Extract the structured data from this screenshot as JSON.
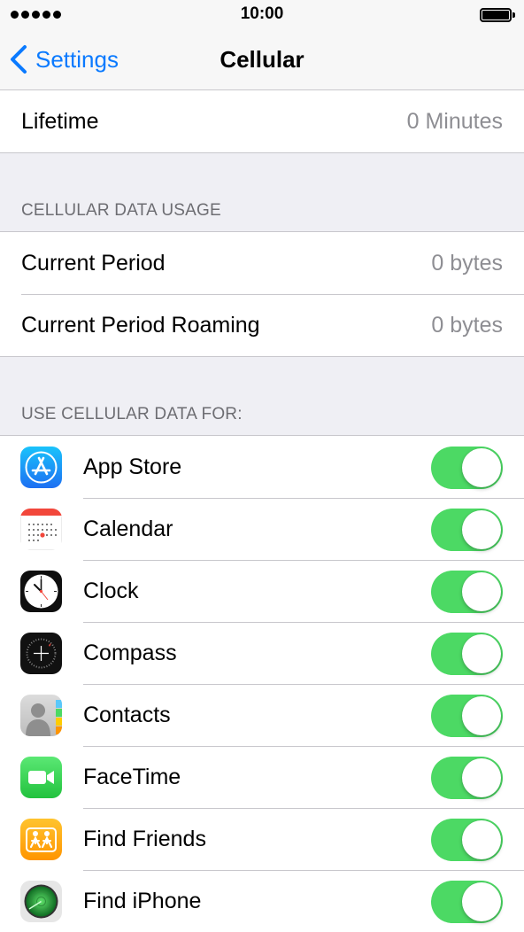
{
  "status_bar": {
    "time": "10:00"
  },
  "nav": {
    "back_label": "Settings",
    "title": "Cellular"
  },
  "call_time": {
    "label": "Lifetime",
    "value": "0 Minutes"
  },
  "data_usage": {
    "header": "CELLULAR DATA USAGE",
    "rows": [
      {
        "label": "Current Period",
        "value": "0 bytes"
      },
      {
        "label": "Current Period Roaming",
        "value": "0 bytes"
      }
    ]
  },
  "use_cellular": {
    "header": "USE CELLULAR DATA FOR:",
    "apps": [
      {
        "label": "App Store",
        "icon": "app-store-icon",
        "enabled": true
      },
      {
        "label": "Calendar",
        "icon": "calendar-icon",
        "enabled": true
      },
      {
        "label": "Clock",
        "icon": "clock-icon",
        "enabled": true
      },
      {
        "label": "Compass",
        "icon": "compass-icon",
        "enabled": true
      },
      {
        "label": "Contacts",
        "icon": "contacts-icon",
        "enabled": true
      },
      {
        "label": "FaceTime",
        "icon": "facetime-icon",
        "enabled": true
      },
      {
        "label": "Find Friends",
        "icon": "find-friends-icon",
        "enabled": true
      },
      {
        "label": "Find iPhone",
        "icon": "find-iphone-icon",
        "enabled": true
      }
    ]
  },
  "colors": {
    "accent": "#0a7aff",
    "toggle_on": "#4cd964",
    "background": "#efeff4",
    "secondary_text": "#8e8e93"
  }
}
